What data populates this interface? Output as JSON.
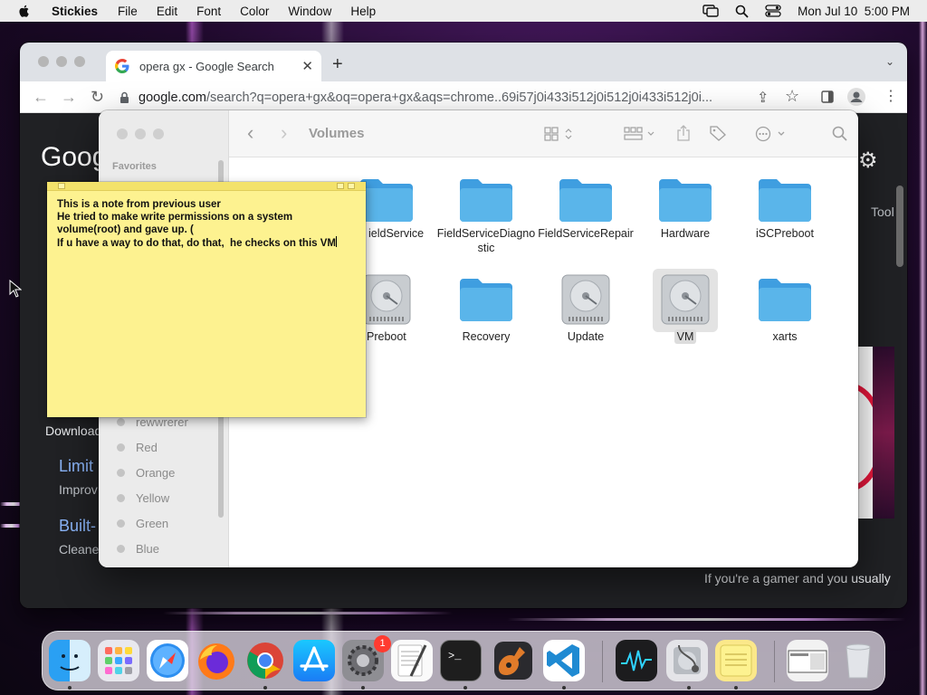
{
  "menubar": {
    "app_name": "Stickies",
    "items": [
      "File",
      "Edit",
      "Font",
      "Color",
      "Window",
      "Help"
    ],
    "clock": "Mon Jul 10  5:00 PM",
    "status_icons": [
      "apple-icon",
      "screen-mirroring-icon",
      "spotlight-search-icon",
      "control-center-icon"
    ]
  },
  "chrome": {
    "tab_title": "opera gx - Google Search",
    "new_tab": "+",
    "url_domain": "google.com",
    "url_rest": "/search?q=opera+gx&oq=opera+gx&aqs=chrome..69i57j0i433i512j0i512j0i433i512j0i...",
    "page": {
      "logo": "Goog",
      "tools": "Tool",
      "download": "Download",
      "link1": "Limit",
      "link1_desc": "Improv",
      "link2": "Built-",
      "link2_desc": "Cleane",
      "snippet": "If you're a gamer and you usually"
    }
  },
  "finder": {
    "title": "Volumes",
    "sidebar_heading": "Favorites",
    "tags": [
      "rewwrerer",
      "Red",
      "Orange",
      "Yellow",
      "Green",
      "Blue"
    ],
    "items": [
      {
        "label": "ieldService",
        "type": "folder"
      },
      {
        "label": "FieldServiceDiagnostic",
        "type": "folder"
      },
      {
        "label": "FieldServiceRepair",
        "type": "folder"
      },
      {
        "label": "Hardware",
        "type": "folder"
      },
      {
        "label": "iSCPreboot",
        "type": "folder"
      },
      {
        "label": "Preboot",
        "type": "disk"
      },
      {
        "label": "Recovery",
        "type": "folder"
      },
      {
        "label": "Update",
        "type": "disk"
      },
      {
        "label": "VM",
        "type": "disk",
        "selected": true
      },
      {
        "label": "xarts",
        "type": "folder"
      }
    ]
  },
  "sticky": {
    "lines": [
      "This is a note from previous user",
      "He tried to make write permissions on a system",
      "volume(root) and gave up. (",
      "If u have a way to do that, do that,  he checks on this VM"
    ]
  },
  "dock": {
    "apps": [
      "Finder",
      "Launchpad",
      "Safari",
      "Firefox",
      "Chrome",
      "App Store",
      "System Settings",
      "TextEdit",
      "Terminal",
      "GarageBand",
      "Visual Studio Code",
      "Activity Monitor",
      "Disk Utility",
      "Stickies",
      "Downloads",
      "Trash"
    ],
    "settings_badge": "1"
  },
  "colors": {
    "folder_blue": "#5ab5ea",
    "sticky_yellow": "#fdf290",
    "badge_red": "#ff3b30",
    "link_blue": "#8ab4f8"
  }
}
